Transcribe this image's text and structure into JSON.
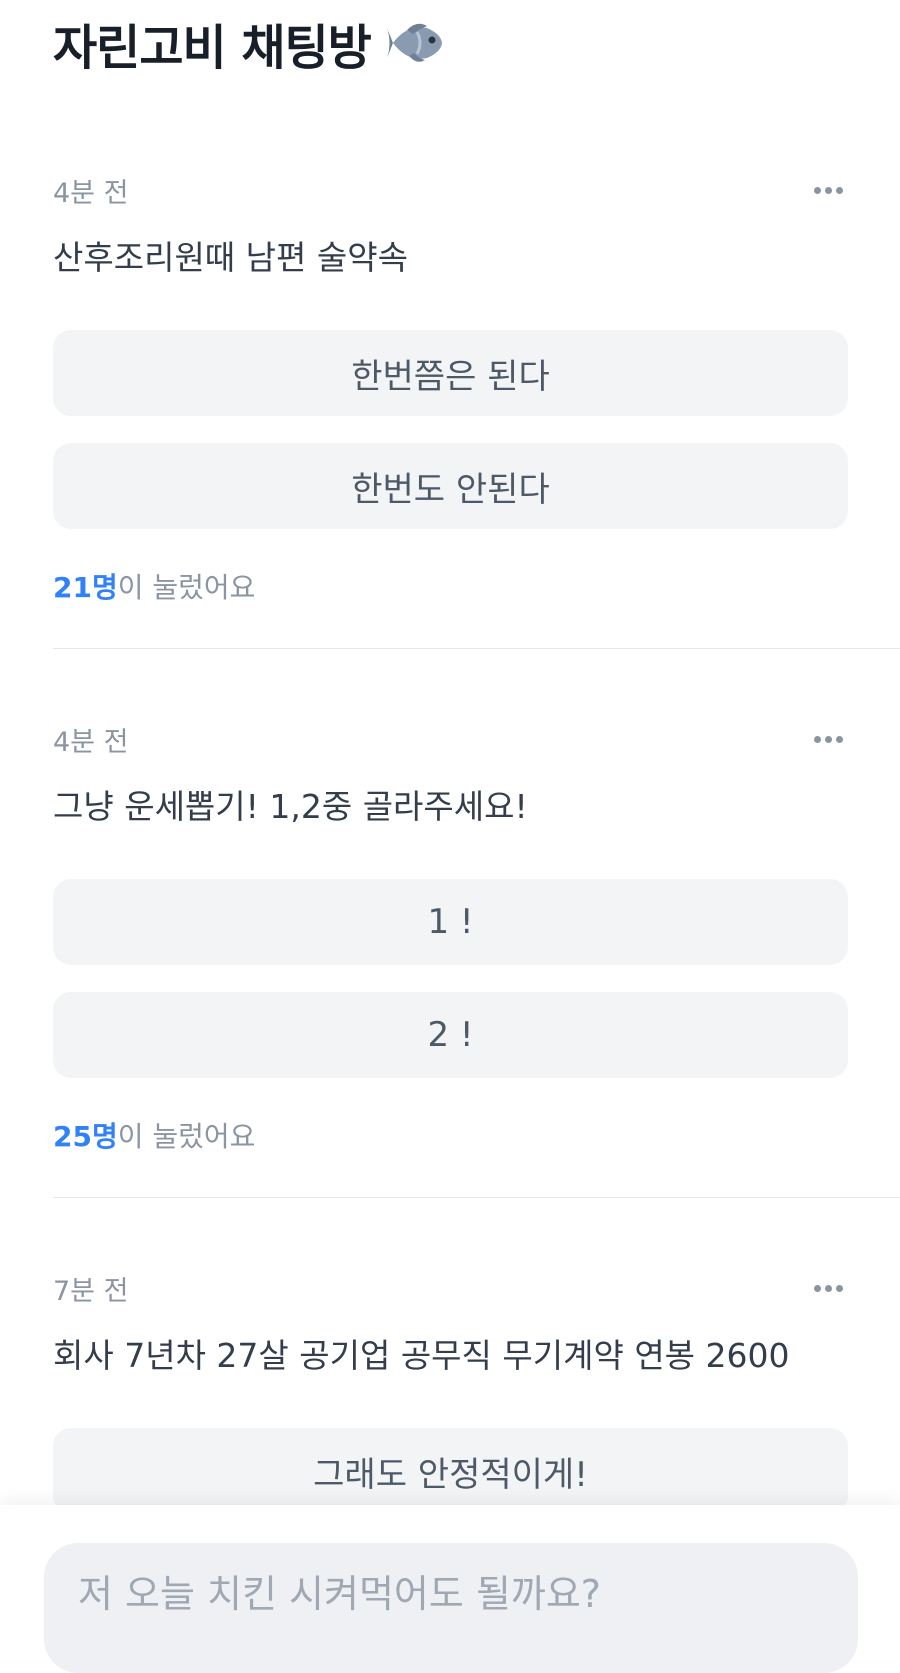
{
  "header": {
    "title": "자린고비 채팅방",
    "icon": "fish-icon"
  },
  "posts": [
    {
      "time": "4분 전",
      "question": "산후조리원때 남편 술약속",
      "options": [
        "한번쯤은 된다",
        "한번도 안된다"
      ],
      "vote_count": "21명",
      "vote_suffix": "이 눌렀어요"
    },
    {
      "time": "4분 전",
      "question": "그냥 운세뽑기! 1,2중 골라주세요!",
      "options": [
        "1 !",
        "2 !"
      ],
      "vote_count": "25명",
      "vote_suffix": "이 눌렀어요"
    },
    {
      "time": "7분 전",
      "question": "회사 7년차 27살 공기업 공무직 무기계약 연봉 2600",
      "options": [
        "그래도 안정적이게!"
      ]
    }
  ],
  "chat": {
    "placeholder": "저 오늘 치킨 시켜먹어도 될까요?"
  },
  "colors": {
    "accent": "#3182f6",
    "option_bg": "#f2f4f6",
    "input_bg": "#eef0f3"
  }
}
